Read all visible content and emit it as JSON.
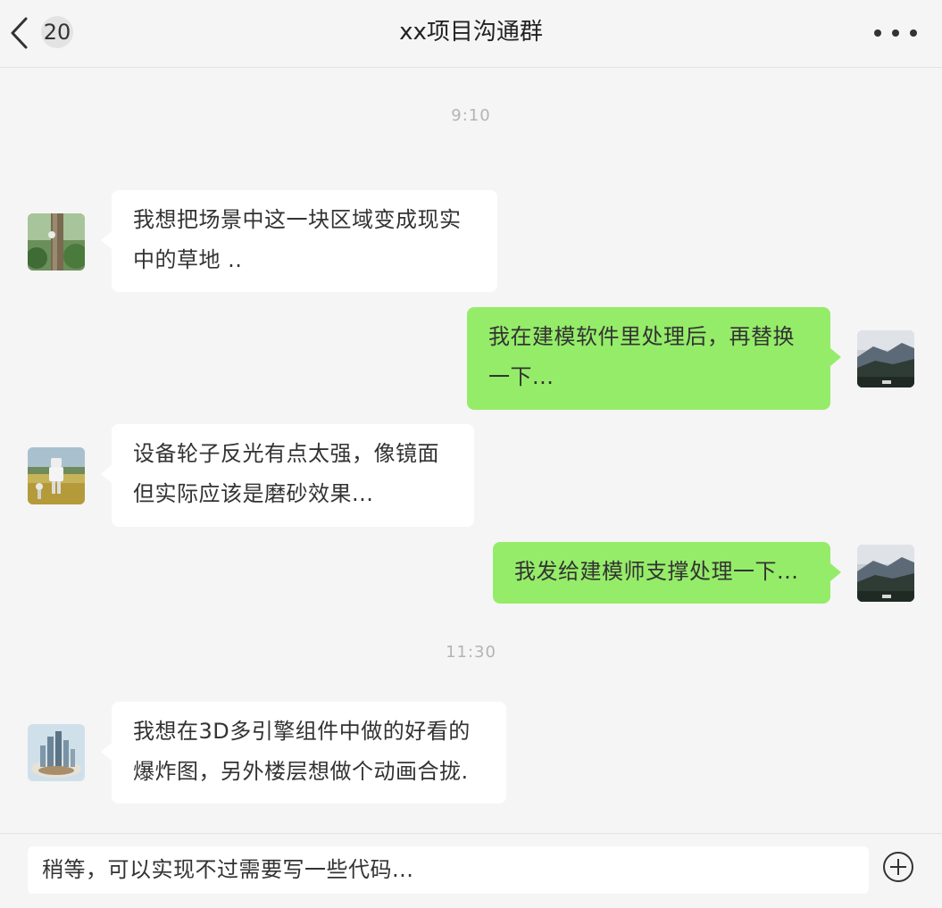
{
  "header": {
    "unread_count": "20",
    "title": "xx项目沟通群"
  },
  "messages": [
    {
      "type": "time",
      "text": "9:10"
    },
    {
      "type": "in",
      "avatar": "forest-avatar",
      "lines": [
        "我想把场景中这一块区域变成现实",
        "中的草地 .."
      ]
    },
    {
      "type": "out",
      "avatar": "mountain-avatar",
      "lines": [
        "我在建模软件里处理后，再替换",
        "一下..."
      ]
    },
    {
      "type": "in",
      "avatar": "robot-avatar",
      "lines": [
        "设备轮子反光有点太强，像镜面",
        "但实际应该是磨砂效果..."
      ]
    },
    {
      "type": "out",
      "avatar": "mountain-avatar",
      "lines": [
        "我发给建模师支撑处理一下..."
      ]
    },
    {
      "type": "time",
      "text": "11:30"
    },
    {
      "type": "in",
      "avatar": "city-avatar",
      "lines": [
        "我想在3D多引擎组件中做的好看的",
        "爆炸图，另外楼层想做个动画合拢."
      ]
    }
  ],
  "input": {
    "value": "稍等，可以实现不过需要写一些代码..."
  },
  "colors": {
    "background": "#f5f5f5",
    "incoming_bubble": "#ffffff",
    "outgoing_bubble": "#95ec69"
  }
}
